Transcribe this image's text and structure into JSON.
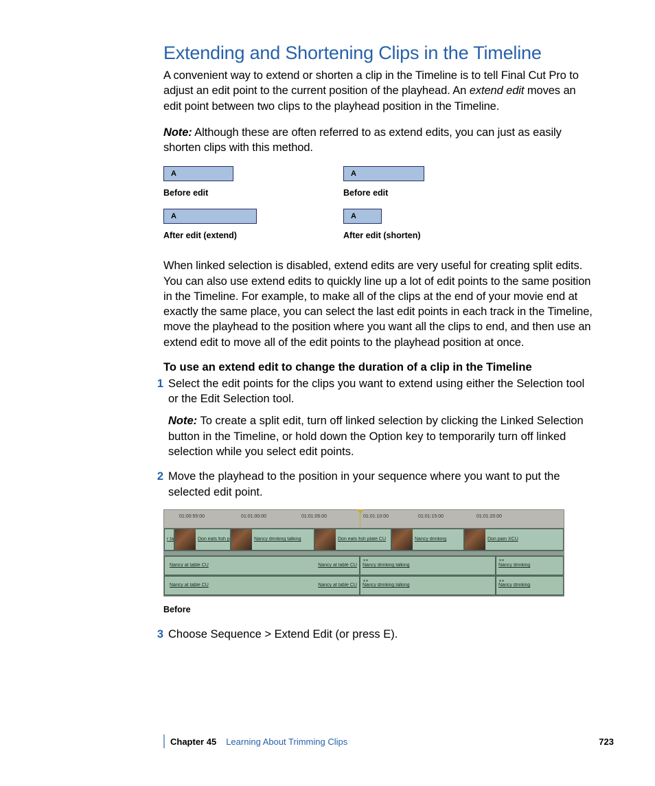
{
  "title": "Extending and Shortening Clips in the Timeline",
  "intro": "A convenient way to extend or shorten a clip in the Timeline is to tell Final Cut Pro to adjust an edit point to the current position of the playhead. An ",
  "intro_em": "extend edit",
  "intro_tail": " moves an edit point between two clips to the playhead position in the Timeline.",
  "note1_lead": "Note:",
  "note1": "  Although these are often referred to as extend edits, you can just as easily shorten clips with this method.",
  "clip_label": "A",
  "cap_before": "Before edit",
  "cap_after_ext": "After edit (extend)",
  "cap_after_short": "After edit (shorten)",
  "para2": "When linked selection is disabled, extend edits are very useful for creating split edits. You can also use extend edits to quickly line up a lot of edit points to the same position in the Timeline. For example, to make all of the clips at the end of your movie end at exactly the same place, you can select the last edit points in each track in the Timeline, move the playhead to the position where you want all the clips to end, and then use an extend edit to move all of the edit points to the playhead position at once.",
  "steps_heading": "To use an extend edit to change the duration of a clip in the Timeline",
  "step1": "Select the edit points for the clips you want to extend using either the Selection tool or the Edit Selection tool.",
  "step1_note_lead": "Note:",
  "step1_note": "  To create a split edit, turn off linked selection by clicking the Linked Selection button in the Timeline, or hold down the Option key to temporarily turn off linked selection while you select edit points.",
  "step2": "Move the playhead to the position in your sequence where you want to put the selected edit point.",
  "step3": "Choose Sequence > Extend Edit (or press E).",
  "timeline_caption": "Before",
  "timecodes": {
    "t1": "01:00:55:00",
    "t2": "01:01:00:00",
    "t3": "01:01:05:00",
    "t4": "01:01:10:00",
    "t5": "01:01:15:00",
    "t6": "01:01:20:00"
  },
  "tl_clips": {
    "v1a": "r tab",
    "v1b": "Don eats fish p",
    "v1c": "Nancy drinking talking",
    "v1d": "Don eats fish plate CU",
    "v1e": "Nancy drinking",
    "v1f": "Don pain XCU",
    "a_left": "Nancy at table CU",
    "a_mid": "Nancy at table CU",
    "a_right1": "Nancy drinking talking",
    "a_right2": "Nancy drinking"
  },
  "footer": {
    "chapter": "Chapter 45",
    "name": "Learning About Trimming Clips",
    "page": "723"
  }
}
